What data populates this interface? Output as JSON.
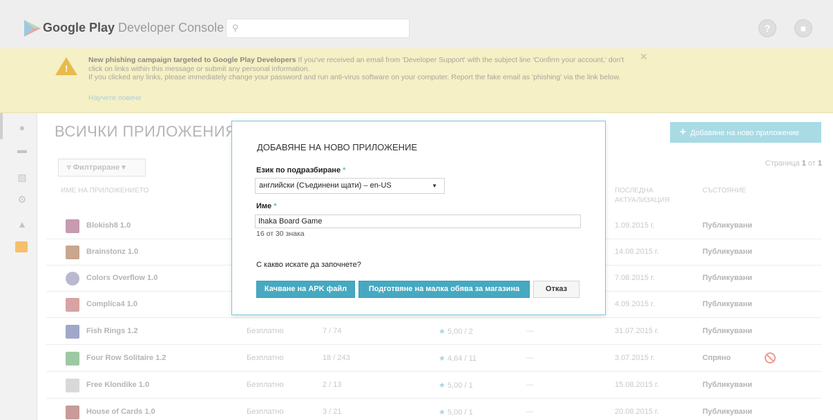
{
  "header": {
    "brand_bold": "Google Play",
    "brand_light": "Developer Console",
    "search_icon": "search-icon",
    "help_icon": "help-icon",
    "account_icon": "account-icon"
  },
  "banner": {
    "title": "New phishing campaign targeted to Google Play Developers",
    "line1": " If you've received an email from 'Developer Support' with the subject line 'Confirm your account,' don't click on links within this message or submit any personal information.",
    "line2": "If you clicked any links, please immediately change your password and run anti-virus software on your computer. Report the fake email as 'phishing' via the link below.",
    "learn_more": "Научете повече",
    "close": "✕"
  },
  "main": {
    "title": "ВСИЧКИ ПРИЛОЖЕНИЯ",
    "add_button": "Добавяне на ново приложение",
    "filter_label": "Филтриране ▾",
    "pager_prefix": "Страница ",
    "pager_page": "1",
    "pager_sep": " от ",
    "pager_total": "1",
    "columns": {
      "name": "ИМЕ НА ПРИЛОЖЕНИЕТО",
      "updated_1": "ПОСЛЕДНА",
      "updated_2": "АКТУАЛИЗАЦИЯ",
      "status": "СЪСТОЯНИЕ"
    },
    "rows": [
      {
        "name": "Blokish8 1.0",
        "price": "",
        "installs": "",
        "rating": "",
        "crash": "",
        "date": "1.09.2015 г.",
        "status": "Публикувани",
        "thumb": "#c79bb0"
      },
      {
        "name": "Brainstonz 1.0",
        "price": "",
        "installs": "",
        "rating": "",
        "crash": "",
        "date": "14.08.2015 г.",
        "status": "Публикувани",
        "thumb": "#c9a68e"
      },
      {
        "name": "Colors Overflow 1.0",
        "price": "",
        "installs": "",
        "rating": "",
        "crash": "",
        "date": "7.08.2015 г.",
        "status": "Публикувани",
        "thumb": "#b9b9d1"
      },
      {
        "name": "Complica4 1.0",
        "price": "",
        "installs": "",
        "rating": "",
        "crash": "",
        "date": "4.09.2015 г.",
        "status": "Публикувани",
        "thumb": "#d8a3a3"
      },
      {
        "name": "Fish Rings 1.2",
        "price": "Безплатно",
        "installs": "7 / 74",
        "rating": "5,00 / 2",
        "crash": "—",
        "date": "31.07.2015 г.",
        "status": "Публикувани",
        "thumb": "#9fa8c7"
      },
      {
        "name": "Four Row Solitaire 1.2",
        "price": "Безплатно",
        "installs": "18 / 243",
        "rating": "4,64 / 11",
        "crash": "—",
        "date": "3.07.2015 г.",
        "status": "Спряно",
        "thumb": "#9cc9a4"
      },
      {
        "name": "Free Klondike 1.0",
        "price": "Безплатно",
        "installs": "2 / 13",
        "rating": "5,00 / 1",
        "crash": "—",
        "date": "15.08.2015 г.",
        "status": "Публикувани",
        "thumb": "#d9d9d9"
      },
      {
        "name": "House of Cards 1.0",
        "price": "Безплатно",
        "installs": "3 / 21",
        "rating": "5,00 / 1",
        "crash": "—",
        "date": "20.08.2015 г.",
        "status": "Публикувани",
        "thumb": "#c99a9a"
      }
    ]
  },
  "modal": {
    "title": "ДОБАВЯНЕ НА НОВО ПРИЛОЖЕНИЕ",
    "lang_label": "Език по подразбиране",
    "lang_value": "английски (Съединени щати) – en-US",
    "name_label": "Име",
    "required_mark": "*",
    "name_value": "Ihaka Board Game",
    "char_count": "16 от 30 знака",
    "question": "С какво искате да започнете?",
    "btn_upload": "Качване на APK файл",
    "btn_listing": "Подготвяне на малка обява за магазина",
    "btn_cancel": "Отказ"
  },
  "colors": {
    "accent": "#46a9c1",
    "banner_bg": "#f5f0c5",
    "warning": "#e8bb4a",
    "stopped": "#ef9a8f"
  }
}
